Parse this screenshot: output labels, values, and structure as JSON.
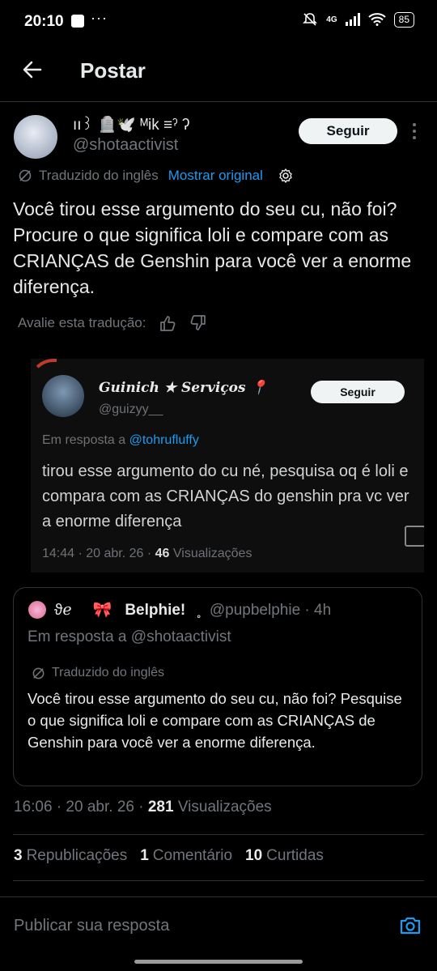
{
  "status": {
    "time": "20:10",
    "network": "4G",
    "battery": "85"
  },
  "header": {
    "title": "Postar"
  },
  "post": {
    "display_name": "ıı꒱ 🪦🕊️ ᴹik ≡ˀ ʔ",
    "handle": "@shotaactivist",
    "follow_label": "Seguir",
    "translated_label": "Traduzido do inglês",
    "show_original": "Mostrar original",
    "text": "Você tirou esse argumento do seu cu, não foi? Procure o que significa loli e compare com as CRIANÇAS de Genshin para você ver a enorme diferença.",
    "rate_translation": "Avalie esta tradução:",
    "timestamp": "16:06 · 20 abr. 26 · ",
    "views_count": "281",
    "views_label": "Visualizações",
    "reposts_count": "3",
    "reposts_label": "Republicações",
    "comments_count": "1",
    "comments_label": "Comentário",
    "likes_count": "10",
    "likes_label": "Curtidas"
  },
  "embedded_image": {
    "name": "Guinich ★ Serviços 📍",
    "handle": "@guizyy__",
    "follow_label": "Seguir",
    "reply_prefix": "Em resposta a ",
    "reply_to": "@tohrufluffy",
    "text": "tirou esse argumento do cu né, pesquisa oq é loli e compara com as CRIANÇAS do genshin pra vc ver a enorme diferença",
    "meta": "14:44 · 20 abr. 26 · ",
    "views_count": "46",
    "views_label": "Visualizações"
  },
  "quote": {
    "name_prefix": "ϑℯ",
    "bow": "🎀",
    "name": "Belphie!",
    "name_suffix": "˳",
    "handle_time": "@pupbelphie · 4h",
    "reply_line": "Em resposta a @shotaactivist",
    "translated_label": "Traduzido do inglês",
    "text": "Você tirou esse argumento do seu cu, não foi? Pesquise o que significa loli e compare com as CRIANÇAS de Genshin para você ver a enorme diferença."
  },
  "reply_bar": {
    "placeholder": "Publicar sua resposta"
  },
  "colors": {
    "accent": "#1d9bf0",
    "background": "#000000",
    "muted": "#71767b"
  }
}
